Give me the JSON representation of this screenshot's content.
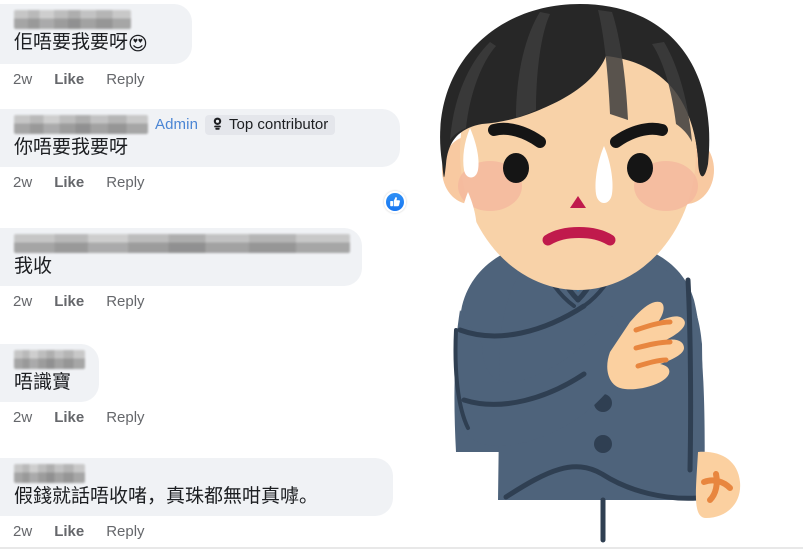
{
  "app": {
    "surface": "facebook-comment-thread",
    "background_color": "#ffffff",
    "bubble_color": "#f0f2f5",
    "accent_color": "#1877f2",
    "text_color": "#1c1e21",
    "meta_text_color": "#65676b",
    "admin_tag_color": "#4a85d4"
  },
  "comments": [
    {
      "author_redacted": true,
      "message": "佢唔要我要呀",
      "emoji": "😍",
      "time": "2w",
      "like_label": "Like",
      "reply_label": "Reply",
      "badges": [],
      "reaction": null
    },
    {
      "author_redacted": true,
      "message": "你唔要我要呀",
      "emoji": "",
      "time": "2w",
      "like_label": "Like",
      "reply_label": "Reply",
      "badges": [
        {
          "type": "admin",
          "label": "Admin"
        },
        {
          "type": "top-contributor",
          "label": "Top contributor",
          "icon": "badge-medal-icon"
        }
      ],
      "reaction": {
        "type": "like",
        "icon": "thumbs-up-icon"
      }
    },
    {
      "author_redacted": true,
      "message": "我收",
      "emoji": "",
      "time": "2w",
      "like_label": "Like",
      "reply_label": "Reply",
      "badges": [],
      "reaction": null
    },
    {
      "author_redacted": true,
      "message": "唔識寶",
      "emoji": "",
      "time": "2w",
      "like_label": "Like",
      "reply_label": "Reply",
      "badges": [],
      "reaction": null
    },
    {
      "author_redacted": true,
      "message": "假錢就話唔收啫，真珠都無咁真嘑。",
      "emoji": "",
      "time": "2w",
      "like_label": "Like",
      "reply_label": "Reply",
      "badges": [],
      "reaction": null
    }
  ],
  "illustration": {
    "name": "worried-businessman-illustration",
    "description": "Cartoon businessman in a navy suit with angry eyebrows, sweat drops and a hand on his chest",
    "colors": {
      "hair": "#272727",
      "hair_highlight": "#3a3a3a",
      "skin": "#f8d2a8",
      "cheek": "#f3b9a4",
      "suit": "#4e637b",
      "suit_line": "#2f3f52",
      "shirt": "#ffffff",
      "tie": "#3a7099",
      "tie_dark": "#2f6186",
      "mouth": "#c01a4c",
      "nose": "#c01a4c",
      "sweat": "#ffffff"
    }
  }
}
